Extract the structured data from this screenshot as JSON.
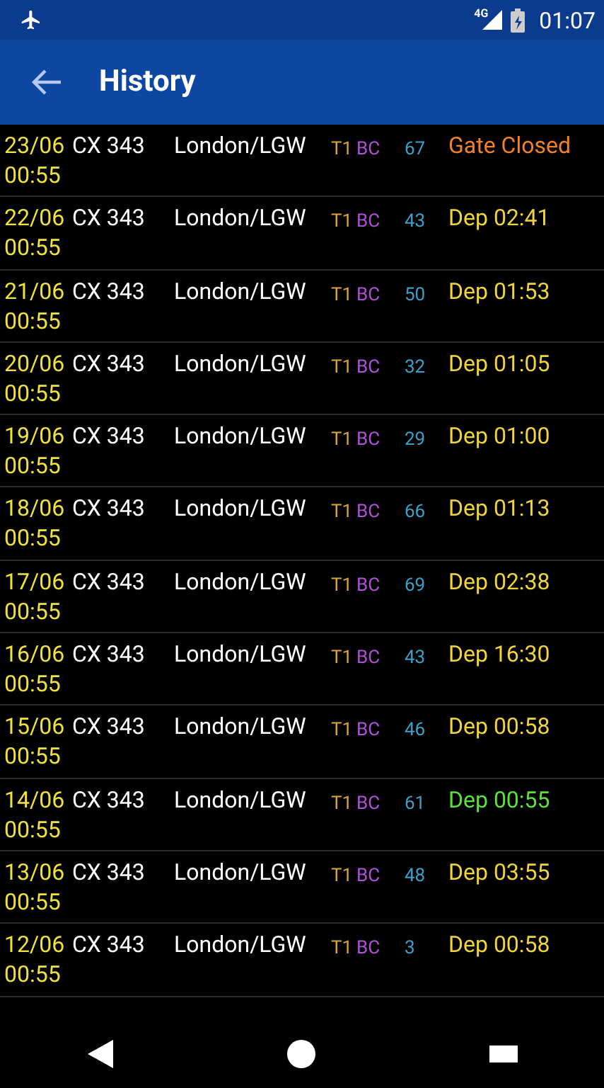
{
  "status_bar": {
    "network": "4G",
    "time": "01:07"
  },
  "app_bar": {
    "title": "History"
  },
  "flights": [
    {
      "date": "23/06",
      "time": "00:55",
      "flight": "CX 343",
      "destination": "London/LGW",
      "terminal": "T1",
      "counter": "BC",
      "gate": "67",
      "status": "Gate Closed",
      "color": "#f0832a"
    },
    {
      "date": "22/06",
      "time": "00:55",
      "flight": "CX 343",
      "destination": "London/LGW",
      "terminal": "T1",
      "counter": "BC",
      "gate": "43",
      "status": "Dep 02:41",
      "color": "#f0d43a"
    },
    {
      "date": "21/06",
      "time": "00:55",
      "flight": "CX 343",
      "destination": "London/LGW",
      "terminal": "T1",
      "counter": "BC",
      "gate": "50",
      "status": "Dep 01:53",
      "color": "#f0d43a"
    },
    {
      "date": "20/06",
      "time": "00:55",
      "flight": "CX 343",
      "destination": "London/LGW",
      "terminal": "T1",
      "counter": "BC",
      "gate": "32",
      "status": "Dep 01:05",
      "color": "#f0d43a"
    },
    {
      "date": "19/06",
      "time": "00:55",
      "flight": "CX 343",
      "destination": "London/LGW",
      "terminal": "T1",
      "counter": "BC",
      "gate": "29",
      "status": "Dep 01:00",
      "color": "#f0d43a"
    },
    {
      "date": "18/06",
      "time": "00:55",
      "flight": "CX 343",
      "destination": "London/LGW",
      "terminal": "T1",
      "counter": "BC",
      "gate": "66",
      "status": "Dep 01:13",
      "color": "#f0d43a"
    },
    {
      "date": "17/06",
      "time": "00:55",
      "flight": "CX 343",
      "destination": "London/LGW",
      "terminal": "T1",
      "counter": "BC",
      "gate": "69",
      "status": "Dep 02:38",
      "color": "#f0d43a"
    },
    {
      "date": "16/06",
      "time": "00:55",
      "flight": "CX 343",
      "destination": "London/LGW",
      "terminal": "T1",
      "counter": "BC",
      "gate": "43",
      "status": "Dep 16:30",
      "color": "#f0d43a"
    },
    {
      "date": "15/06",
      "time": "00:55",
      "flight": "CX 343",
      "destination": "London/LGW",
      "terminal": "T1",
      "counter": "BC",
      "gate": "46",
      "status": "Dep 00:58",
      "color": "#f0d43a"
    },
    {
      "date": "14/06",
      "time": "00:55",
      "flight": "CX 343",
      "destination": "London/LGW",
      "terminal": "T1",
      "counter": "BC",
      "gate": "61",
      "status": "Dep 00:55",
      "color": "#5ee03a"
    },
    {
      "date": "13/06",
      "time": "00:55",
      "flight": "CX 343",
      "destination": "London/LGW",
      "terminal": "T1",
      "counter": "BC",
      "gate": "48",
      "status": "Dep 03:55",
      "color": "#f0d43a"
    },
    {
      "date": "12/06",
      "time": "00:55",
      "flight": "CX 343",
      "destination": "London/LGW",
      "terminal": "T1",
      "counter": "BC",
      "gate": "3",
      "status": "Dep 00:58",
      "color": "#f0d43a"
    }
  ]
}
